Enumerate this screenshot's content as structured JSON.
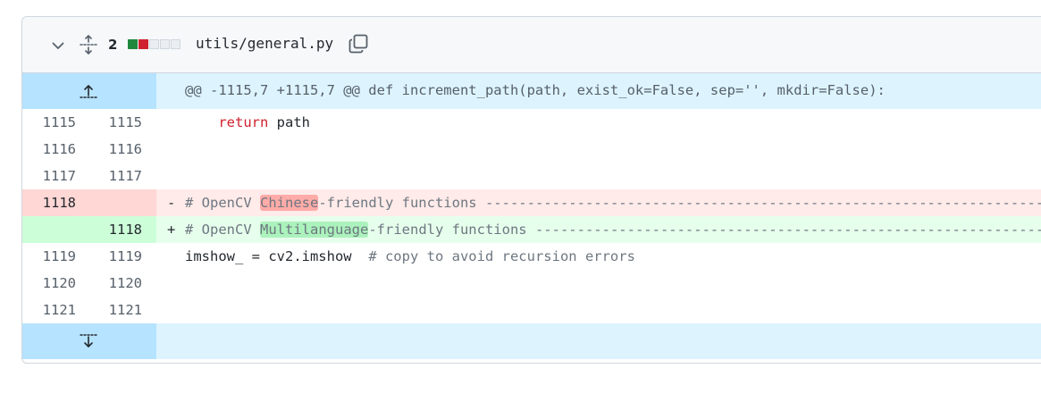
{
  "file": {
    "change_count": "2",
    "name": "utils/general.py",
    "diffstat": [
      "#1f883d",
      "#cf222e",
      "#eaeef2",
      "#eaeef2",
      "#eaeef2"
    ]
  },
  "hunk": {
    "header": "@@ -1115,7 +1115,7 @@ def increment_path(path, exist_ok=False, sep='', mkdir=False):"
  },
  "lines": [
    {
      "old": "1115",
      "new": "1115",
      "kw": "return",
      "rest": " path"
    },
    {
      "old": "1116",
      "new": "1116"
    },
    {
      "old": "1117",
      "new": "1117"
    },
    {
      "old": "1118",
      "marker": "-",
      "pre": "# OpenCV ",
      "hl": "Chinese",
      "post": "-friendly functions ------------------------------------------------------------------------------------"
    },
    {
      "new": "1118",
      "marker": "+",
      "pre": "# OpenCV ",
      "hl": "Multilanguage",
      "post": "-friendly functions ------------------------------------------------------------------------------------"
    },
    {
      "old": "1119",
      "new": "1119",
      "code": "imshow_ = cv2.imshow  ",
      "comment": "# copy to avoid recursion errors"
    },
    {
      "old": "1120",
      "new": "1120"
    },
    {
      "old": "1121",
      "new": "1121"
    }
  ],
  "icons": {
    "collapse": "chevron-down-icon",
    "expand_all": "unfold-icon",
    "copy": "copy-icon",
    "expand_up": "fold-up-icon",
    "expand_down": "fold-down-icon"
  }
}
